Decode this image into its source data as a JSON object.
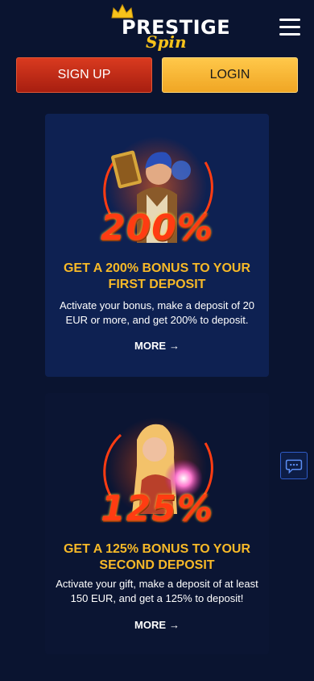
{
  "header": {
    "logo_line1": "PRESTIGE",
    "logo_line2": "Spin",
    "menu_icon": "hamburger-menu-icon"
  },
  "auth": {
    "signup_label": "SIGN UP",
    "login_label": "LOGIN"
  },
  "promos": [
    {
      "percent": "200%",
      "title": "GET A 200% BONUS TO YOUR FIRST DEPOSIT",
      "description": "Activate your bonus, make a deposit of 20 EUR or more, and get 200% to deposit.",
      "more_label": "MORE"
    },
    {
      "percent": "125%",
      "title": "GET A 125% BONUS TO YOUR SECOND DEPOSIT",
      "description": "Activate your gift, make a deposit of at least 150 EUR, and get a 125% to deposit!",
      "more_label": "MORE"
    }
  ],
  "chat": {
    "icon": "chat-bubble-icon"
  },
  "colors": {
    "background": "#0a1430",
    "accent_yellow": "#f7b928",
    "signup_red": "#c62a17",
    "login_orange": "#fbb93a"
  }
}
